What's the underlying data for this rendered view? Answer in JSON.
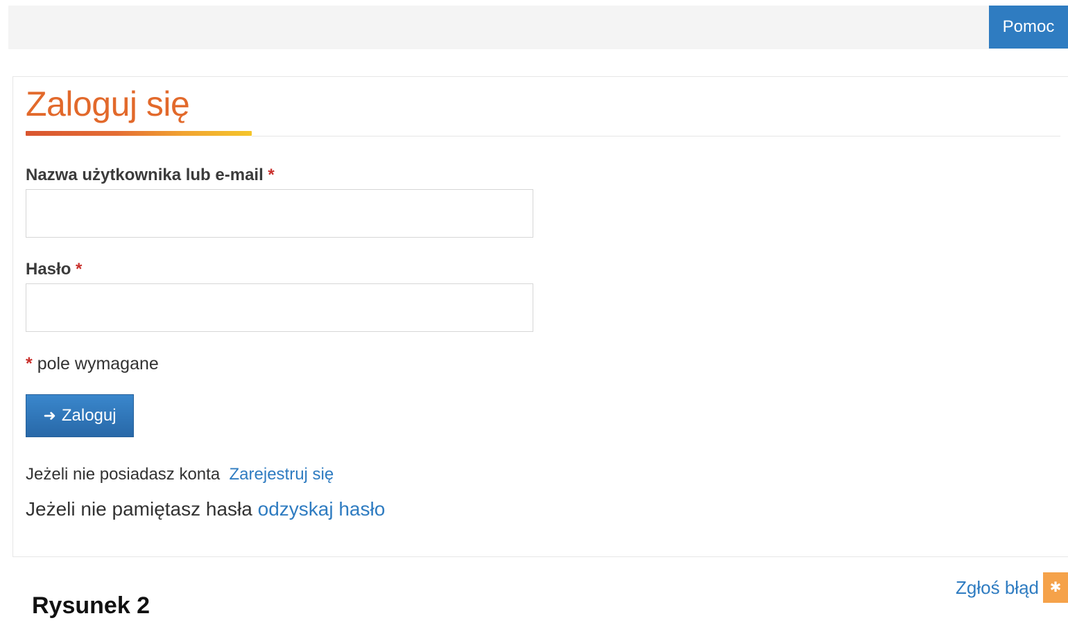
{
  "topbar": {
    "help_label": "Pomoc"
  },
  "form": {
    "title": "Zaloguj się",
    "username_label": "Nazwa użytkownika lub e-mail",
    "password_label": "Hasło",
    "required_mark": "*",
    "required_note": "pole wymagane",
    "submit_label": "Zaloguj",
    "register_prompt": "Jeżeli nie posiadasz konta",
    "register_link": "Zarejestruj się",
    "recover_prompt": "Jeżeli nie pamiętasz hasła",
    "recover_link": "odzyskaj hasło",
    "username_value": "",
    "password_value": ""
  },
  "footer": {
    "report_label": "Zgłoś błąd",
    "report_icon": "bug-icon"
  },
  "caption": "Rysunek 2",
  "colors": {
    "accent_blue": "#2f7cc1",
    "title_orange": "#e2692b",
    "required_red": "#c9302c"
  }
}
